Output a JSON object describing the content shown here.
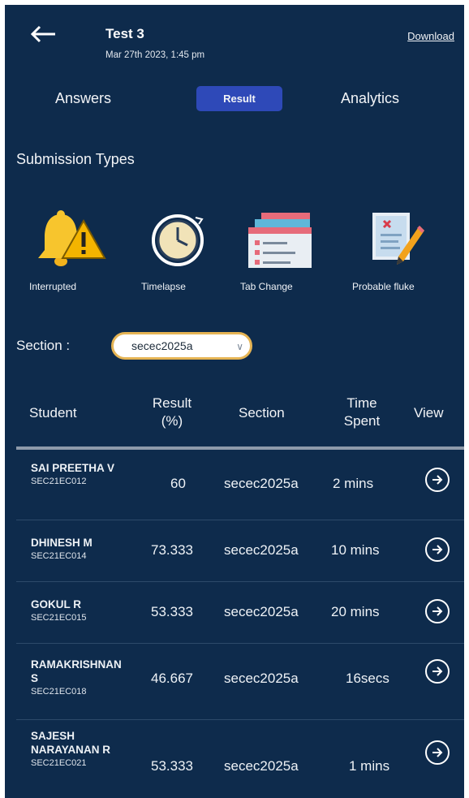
{
  "header": {
    "title": "Test 3",
    "subtitle": "Mar 27th 2023, 1:45 pm",
    "download": "Download"
  },
  "tabs": [
    {
      "label": "Answers"
    },
    {
      "label": "Result",
      "active": true
    },
    {
      "label": "Analytics"
    }
  ],
  "submission": {
    "title": "Submission Types",
    "types": [
      {
        "label": "Interrupted",
        "icon": "bell-warning-icon"
      },
      {
        "label": "Timelapse",
        "icon": "clock-icon"
      },
      {
        "label": "Tab Change",
        "icon": "browser-tabs-icon"
      },
      {
        "label": "Probable fluke",
        "icon": "document-pencil-icon"
      }
    ]
  },
  "filter": {
    "label": "Section :",
    "selected": "secec2025a"
  },
  "table": {
    "headers": [
      "Student",
      "Result (%)",
      "Section",
      "Time Spent",
      "View"
    ],
    "rows": [
      {
        "name": "SAI PREETHA V",
        "reg": "SEC21EC012",
        "result": "60",
        "section": "secec2025a",
        "time": "2 mins"
      },
      {
        "name": "DHINESH M",
        "reg": "SEC21EC014",
        "result": "73.333",
        "section": "secec2025a",
        "time": "10 mins"
      },
      {
        "name": "GOKUL R",
        "reg": "SEC21EC015",
        "result": "53.333",
        "section": "secec2025a",
        "time": "20 mins"
      },
      {
        "name": "RAMAKRISHNAN S",
        "reg": "SEC21EC018",
        "result": "46.667",
        "section": "secec2025a",
        "time": "16secs"
      },
      {
        "name": "SAJESH NARAYANAN R",
        "reg": "SEC21EC021",
        "result": "53.333",
        "section": "secec2025a",
        "time": "1 mins"
      }
    ]
  },
  "colors": {
    "background": "#0e2b4c",
    "active_tab": "#2e49b8",
    "select_border": "#e5b454"
  }
}
